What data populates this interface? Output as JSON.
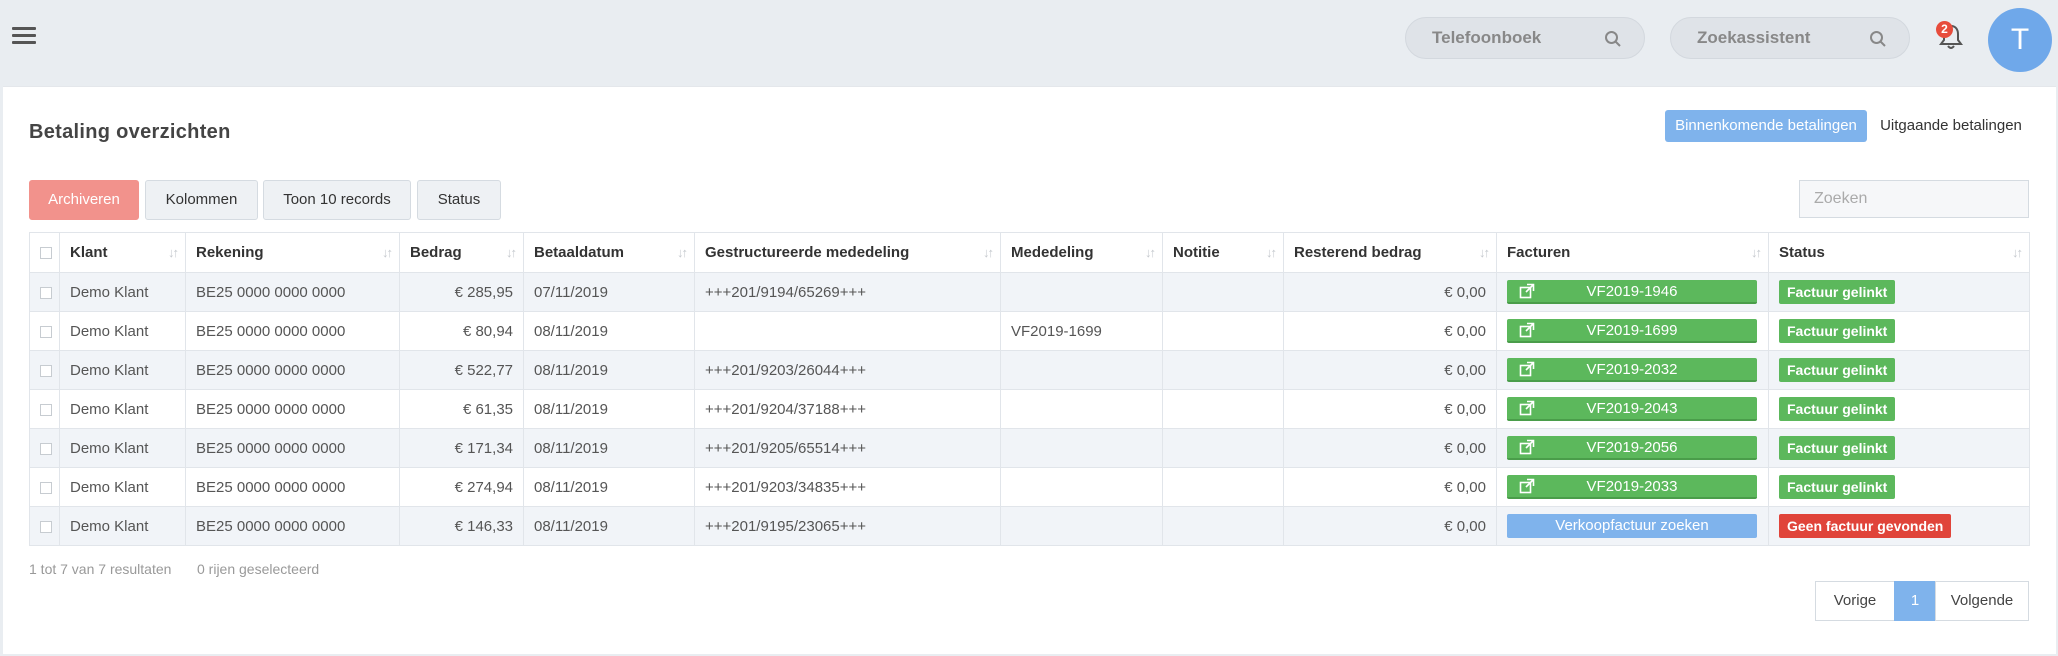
{
  "header": {
    "phonebook_placeholder": "Telefoonboek",
    "assistant_placeholder": "Zoekassistent",
    "notification_count": "2",
    "avatar_initial": "T"
  },
  "page": {
    "title": "Betaling overzichten",
    "tab_incoming": "Binnenkomende betalingen",
    "tab_outgoing": "Uitgaande betalingen"
  },
  "toolbar": {
    "archive": "Archiveren",
    "columns": "Kolommen",
    "records": "Toon 10 records",
    "status": "Status",
    "search_placeholder": "Zoeken"
  },
  "table": {
    "headers": [
      "Klant",
      "Rekening",
      "Bedrag",
      "Betaaldatum",
      "Gestructureerde mededeling",
      "Mededeling",
      "Notitie",
      "Resterend bedrag",
      "Facturen",
      "Status"
    ],
    "rows": [
      {
        "klant": "Demo Klant",
        "rekening": "BE25 0000 0000 0000",
        "bedrag": "€ 285,95",
        "datum": "07/11/2019",
        "gestruct": "+++201/9194/65269+++",
        "mededeling": "",
        "notitie": "",
        "resterend": "€ 0,00",
        "factuur": "VF2019-1946",
        "status": "Factuur gelinkt"
      },
      {
        "klant": "Demo Klant",
        "rekening": "BE25 0000 0000 0000",
        "bedrag": "€ 80,94",
        "datum": "08/11/2019",
        "gestruct": "",
        "mededeling": "VF2019-1699",
        "notitie": "",
        "resterend": "€ 0,00",
        "factuur": "VF2019-1699",
        "status": "Factuur gelinkt"
      },
      {
        "klant": "Demo Klant",
        "rekening": "BE25 0000 0000 0000",
        "bedrag": "€ 522,77",
        "datum": "08/11/2019",
        "gestruct": "+++201/9203/26044+++",
        "mededeling": "",
        "notitie": "",
        "resterend": "€ 0,00",
        "factuur": "VF2019-2032",
        "status": "Factuur gelinkt"
      },
      {
        "klant": "Demo Klant",
        "rekening": "BE25 0000 0000 0000",
        "bedrag": "€ 61,35",
        "datum": "08/11/2019",
        "gestruct": "+++201/9204/37188+++",
        "mededeling": "",
        "notitie": "",
        "resterend": "€ 0,00",
        "factuur": "VF2019-2043",
        "status": "Factuur gelinkt"
      },
      {
        "klant": "Demo Klant",
        "rekening": "BE25 0000 0000 0000",
        "bedrag": "€ 171,34",
        "datum": "08/11/2019",
        "gestruct": "+++201/9205/65514+++",
        "mededeling": "",
        "notitie": "",
        "resterend": "€ 0,00",
        "factuur": "VF2019-2056",
        "status": "Factuur gelinkt"
      },
      {
        "klant": "Demo Klant",
        "rekening": "BE25 0000 0000 0000",
        "bedrag": "€ 274,94",
        "datum": "08/11/2019",
        "gestruct": "+++201/9203/34835+++",
        "mededeling": "",
        "notitie": "",
        "resterend": "€ 0,00",
        "factuur": "VF2019-2033",
        "status": "Factuur gelinkt"
      },
      {
        "klant": "Demo Klant",
        "rekening": "BE25 0000 0000 0000",
        "bedrag": "€ 146,33",
        "datum": "08/11/2019",
        "gestruct": "+++201/9195/23065+++",
        "mededeling": "",
        "notitie": "",
        "resterend": "€ 0,00",
        "factuur": "Verkoopfactuur zoeken",
        "status": "Geen factuur gevonden"
      }
    ]
  },
  "footer": {
    "results": "1 tot 7 van 7 resultaten",
    "selected": "0 rijen geselecteerd",
    "prev": "Vorige",
    "page": "1",
    "next": "Volgende"
  },
  "colors": {
    "accent": "#7fb3ec",
    "success": "#5cb85c",
    "danger": "#e0443a",
    "archive": "#f2928c"
  }
}
